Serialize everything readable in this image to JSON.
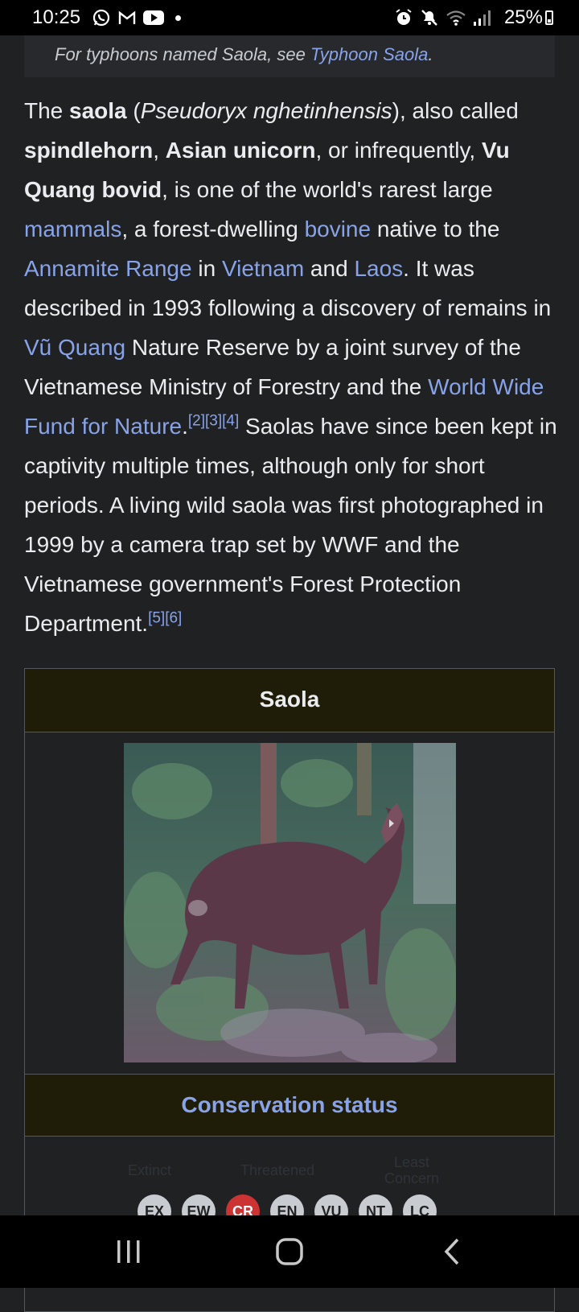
{
  "status_bar": {
    "time": "10:25",
    "battery": "25%",
    "left_icons": [
      "whatsapp-icon",
      "gmail-icon",
      "youtube-icon",
      "dot-icon"
    ],
    "right_icons": [
      "alarm-icon",
      "mute-icon",
      "wifi-icon",
      "signal-icon"
    ]
  },
  "hatnote": {
    "prefix": "For typhoons named Saola, see ",
    "link": "Typhoon Saola",
    "suffix": "."
  },
  "article": {
    "t1": "The ",
    "b_saola": "saola",
    "t2": " (",
    "i_sci": "Pseudoryx nghetinhensis",
    "t3": "), also called ",
    "b_spindlehorn": "spindlehorn",
    "t4": ", ",
    "b_unicorn": "Asian unicorn",
    "t5": ", or infrequently, ",
    "b_vuquang": "Vu Quang bovid",
    "t6": ", is one of the world's rarest large ",
    "link_mammals": "mammals",
    "t7": ", a forest-dwelling ",
    "link_bovine": "bovine",
    "t8": " native to the ",
    "link_annamite": "Annamite Range",
    "t9": " in ",
    "link_vietnam": "Vietnam",
    "t10": " and ",
    "link_laos": "Laos",
    "t11": ". It was described in 1993 following a discovery of remains in ",
    "link_vuquang": "Vũ Quang",
    "t12": " Nature Reserve by a joint survey of the Vietnamese Ministry of Forestry and the ",
    "link_wwf": "World Wide Fund for Nature",
    "t13": ".",
    "ref_2": "[2]",
    "ref_3": "[3]",
    "ref_4": "[4]",
    "t14": " Saolas have since been kept in captivity multiple times, although only for short periods. A living wild saola was first photographed in 1999 by a camera trap set by WWF and the Vietnamese government's Forest Protection Department.",
    "ref_5": "[5]",
    "ref_6": "[6]"
  },
  "infobox": {
    "title": "Saola",
    "conservation_heading": "Conservation status",
    "status_labels": [
      "Extinct",
      "Threatened",
      "Least Concern"
    ],
    "status_codes": [
      "EX",
      "EW",
      "CR",
      "EN",
      "VU",
      "NT",
      "LC"
    ],
    "selected_status": "CR"
  },
  "colors": {
    "background": "#202122",
    "link": "#88a3e8",
    "infobox_header": "#1f1c08",
    "critically_endangered": "#cc3333"
  }
}
